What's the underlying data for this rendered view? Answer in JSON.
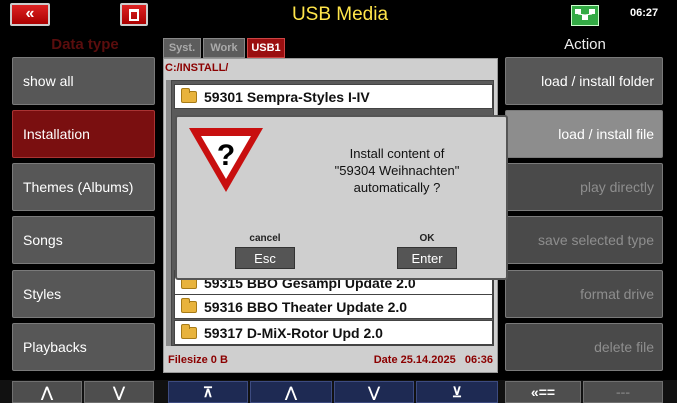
{
  "titlebar": {
    "back_label": "«",
    "title": "USB Media",
    "time": "06:27",
    "net_icon_text": "",
    "icons": [
      "back-arrows-icon",
      "trash-icon",
      "network-icon"
    ]
  },
  "left": {
    "header": "Data type",
    "items": [
      {
        "label": "show all"
      },
      {
        "label": "Installation"
      },
      {
        "label": "Themes (Albums)"
      },
      {
        "label": "Songs"
      },
      {
        "label": "Styles"
      },
      {
        "label": "Playbacks"
      }
    ]
  },
  "right": {
    "header": "Action",
    "items": [
      {
        "label": "load  /  install folder"
      },
      {
        "label": "load  /  install file"
      },
      {
        "label": "play directly"
      },
      {
        "label": "save selected type"
      },
      {
        "label": "format drive"
      },
      {
        "label": "delete file"
      }
    ]
  },
  "center": {
    "tabs": [
      "Syst.",
      "Work",
      "USB1"
    ],
    "path": "C:/INSTALL/",
    "files": [
      "59301 Sempra-Styles I-IV",
      "59315 BBO Gesampl Update 2.0",
      "59316 BBO Theater Update 2.0",
      "59317 D-MiX-Rotor Upd 2.0"
    ],
    "filesize": "Filesize 0 B",
    "date": "Date 25.14.2025",
    "time": "06:36"
  },
  "dialog": {
    "line1": "Install content of",
    "line2": "\"59304 Weihnachten\"",
    "line3": "automatically ?",
    "cancel_caption": "cancel",
    "cancel_label": "Esc",
    "ok_caption": "OK",
    "ok_label": "Enter"
  },
  "bottom": {
    "buttons": [
      "⋀",
      "⋁",
      "⊼",
      "⋀",
      "⋁",
      "⊻",
      "«==",
      "---"
    ]
  },
  "colors": {
    "title": "#ffe54a",
    "selected": "#7a0f10",
    "button": "#575757",
    "nav": "#1e2a53"
  }
}
